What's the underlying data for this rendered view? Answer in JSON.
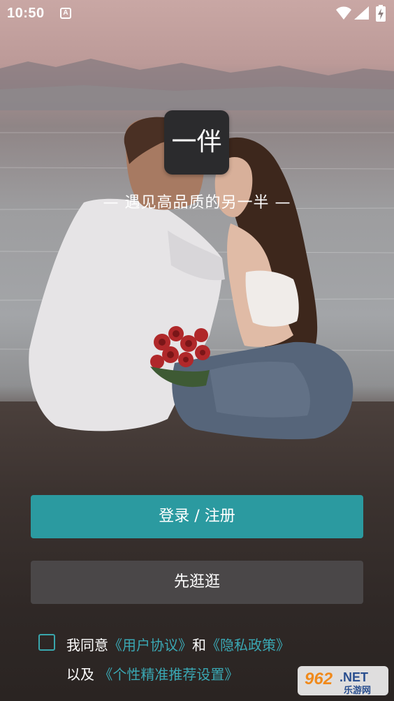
{
  "status_bar": {
    "time": "10:50",
    "notification_letter": "A"
  },
  "logo": {
    "text": "一伴"
  },
  "slogan": "— 遇见高品质的另一半 —",
  "buttons": {
    "login_register": "登录 / 注册",
    "browse": "先逛逛"
  },
  "agreement": {
    "prefix": "我同意",
    "user_agreement": "《用户协议》",
    "and": "和",
    "privacy_policy": "《隐私政策》",
    "also": "以及",
    "personalized_settings": "《个性精准推荐设置》",
    "checked": false
  },
  "watermark": {
    "number": "962",
    "domain": ".NET",
    "site_name": "乐游网"
  },
  "colors": {
    "accent": "#2b9aa0",
    "link": "#3aa7b3",
    "secondary_button": "#4a4748"
  }
}
